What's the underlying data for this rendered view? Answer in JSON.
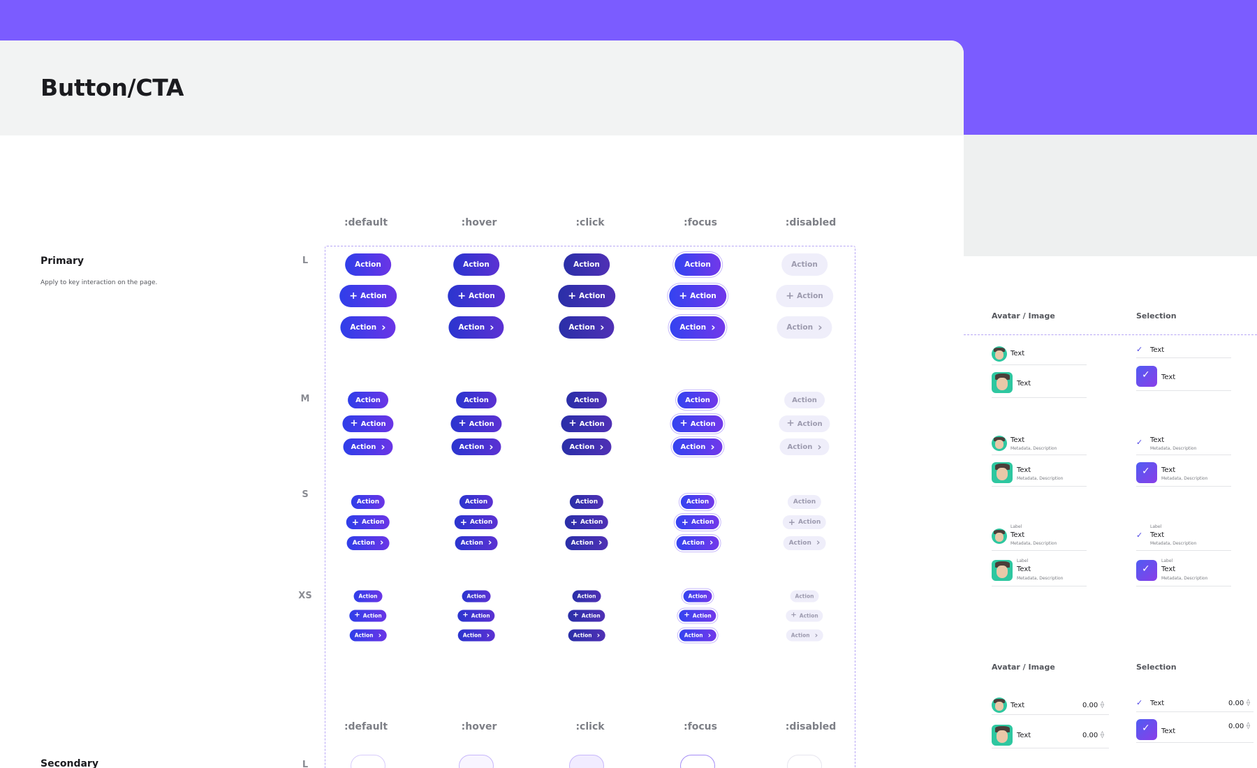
{
  "page": {
    "title": "Button/CTA"
  },
  "colors": {
    "brand": "#7b5cff",
    "primary_start": "#2f3ee9",
    "primary_end": "#6a35e6",
    "disabled_bg": "#efeefa",
    "dashed_guide": "#b7a6f5"
  },
  "states": [
    ":default",
    ":hover",
    ":click",
    ":focus",
    ":disabled"
  ],
  "sizes": [
    "L",
    "M",
    "S",
    "XS"
  ],
  "primary": {
    "title": "Primary",
    "description": "Apply to key interaction on the page."
  },
  "secondary": {
    "title": "Secondary",
    "first_size": "L"
  },
  "button": {
    "label": "Action",
    "variants": [
      "text-only",
      "leading-plus-icon",
      "trailing-chevron-icon"
    ]
  },
  "right_panel": {
    "sections": [
      {
        "heading_left": "Avatar / Image",
        "heading_right": "Selection"
      },
      {
        "heading_left": "Avatar / Image",
        "heading_right": "Selection"
      }
    ],
    "item_text": "Text",
    "item_meta": "Metadata, Description",
    "item_label": "Label",
    "item_value": "0.00"
  }
}
